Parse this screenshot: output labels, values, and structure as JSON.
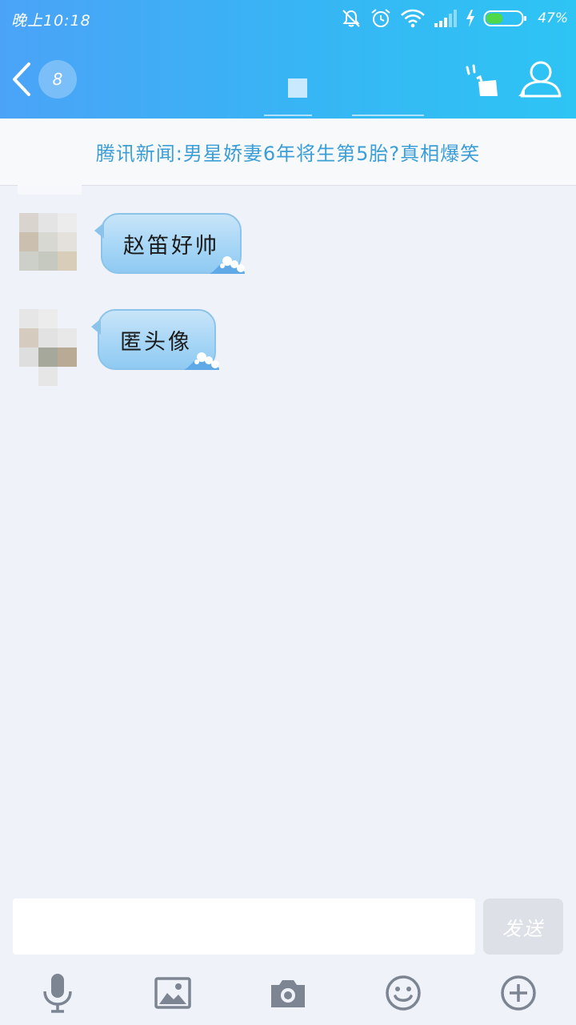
{
  "status_bar": {
    "time": "晚上10:18",
    "battery_percent": "47%",
    "battery_level": 0.47,
    "icons": [
      "mute-bell-icon",
      "alarm-icon",
      "wifi-icon",
      "signal-icon",
      "charging-icon",
      "battery-icon"
    ]
  },
  "header": {
    "back_icon": "chevron-left-icon",
    "unread_count": "8",
    "right_icons": [
      "phone-icon",
      "profile-icon"
    ]
  },
  "news_banner": {
    "text": "腾讯新闻:男星娇妻6年将生第5胎?真相爆笑"
  },
  "messages": [
    {
      "sender": "other",
      "text": "赵笛好帅"
    },
    {
      "sender": "other",
      "text": "匿头像"
    }
  ],
  "input": {
    "placeholder": "",
    "value": "",
    "send_label": "发送"
  },
  "toolbar": {
    "items": [
      "microphone-icon",
      "image-icon",
      "camera-icon",
      "emoji-icon",
      "plus-icon"
    ]
  },
  "colors": {
    "header_gradient_start": "#4ba3f7",
    "header_gradient_end": "#2ec4f4",
    "chat_background": "#eff2f8",
    "news_text": "#3b9ed6",
    "bubble": "#a7d6f6",
    "toolbar_icon": "#7d8592"
  }
}
